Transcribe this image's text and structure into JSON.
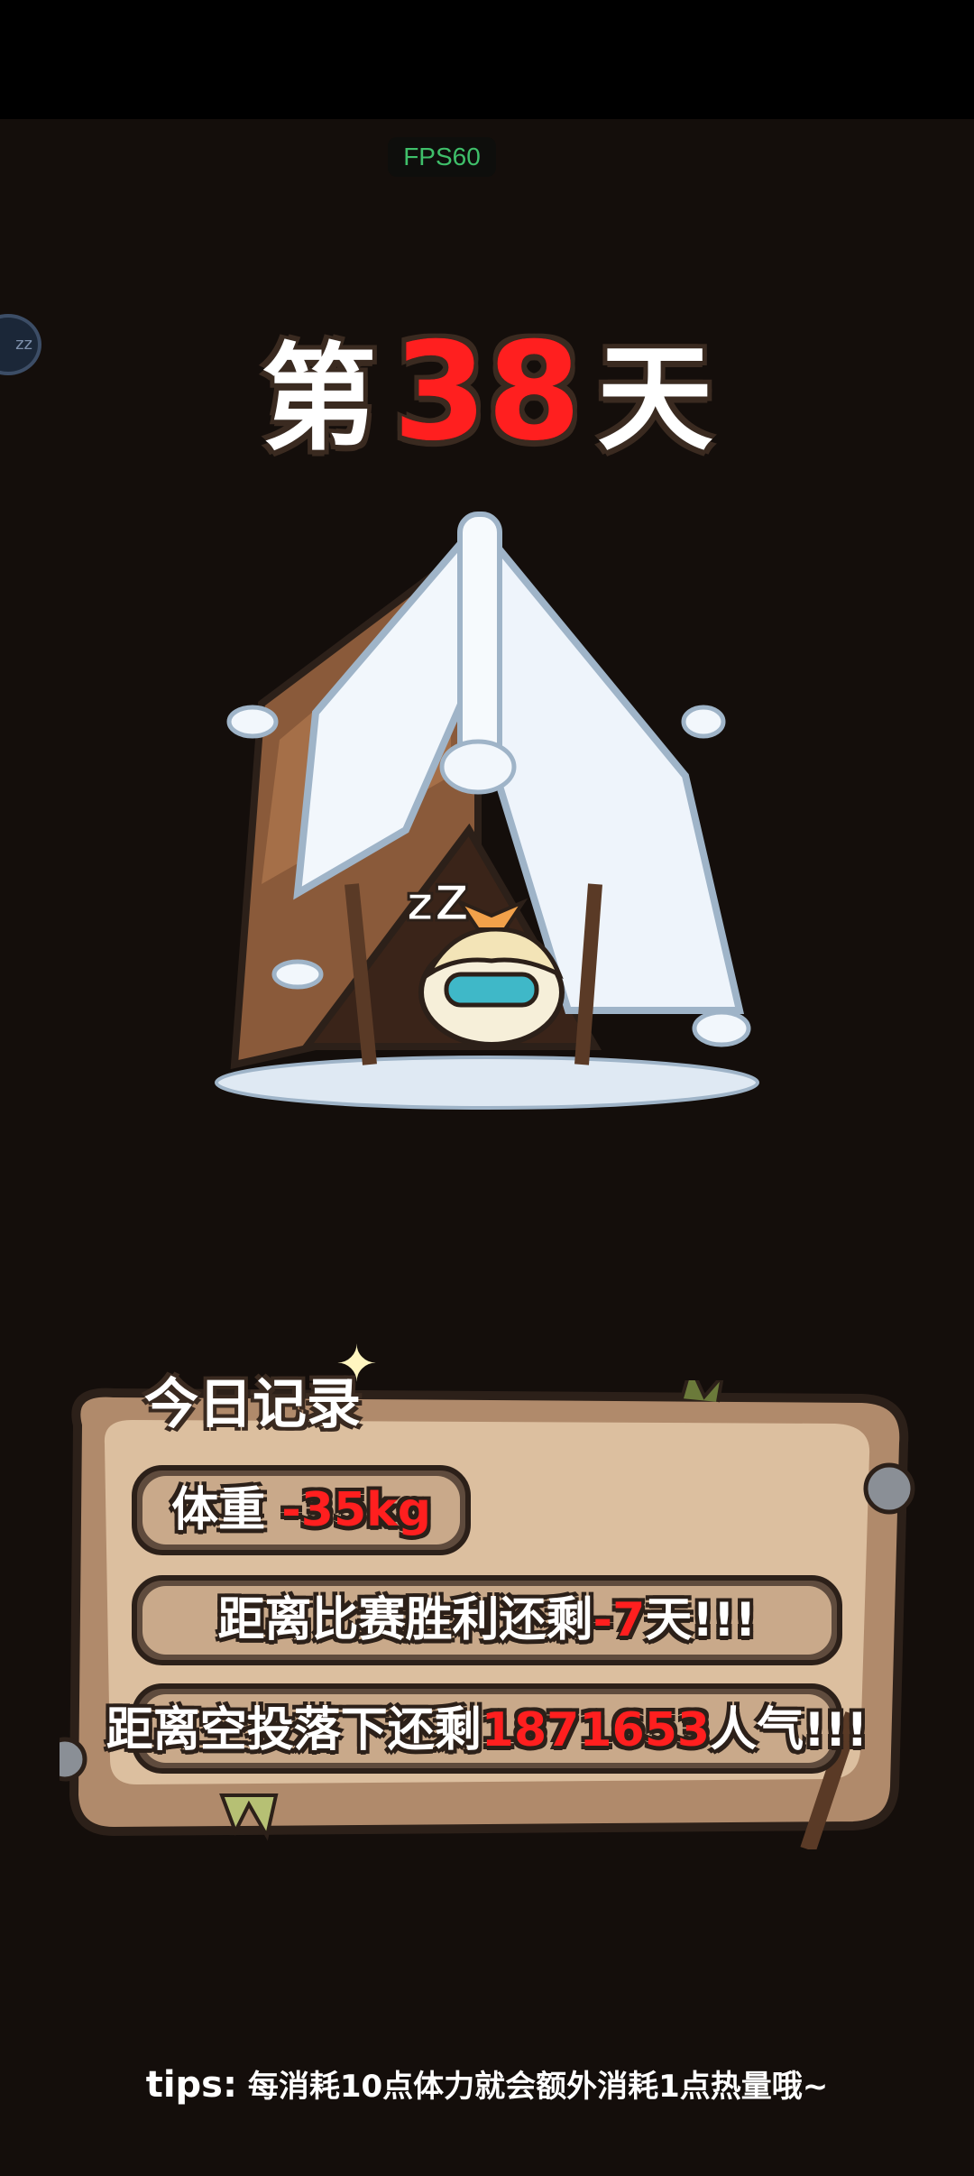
{
  "overlay": {
    "fps_text": "FPS60",
    "sleep_button_text": "zz"
  },
  "day": {
    "prefix": "第",
    "number": "38",
    "suffix": "天"
  },
  "scene": {
    "character_snore": "zZ"
  },
  "record": {
    "title": "今日记录",
    "weight_label": "体重",
    "weight_value": "-35kg",
    "match_prefix": "距离比赛胜利还剩",
    "match_value": "-7",
    "match_suffix": "天!!!",
    "airdrop_prefix": "距离空投落下还剩",
    "airdrop_value": "1871653",
    "airdrop_suffix": "人气!!!"
  },
  "tips": {
    "label": "tips:",
    "text": "每消耗10点体力就会额外消耗1点热量哦~"
  },
  "colors": {
    "background": "#140e0b",
    "highlight_red": "#ff1f1f",
    "fps_green": "#3fbf6a",
    "board_tan": "#c9a98a"
  }
}
